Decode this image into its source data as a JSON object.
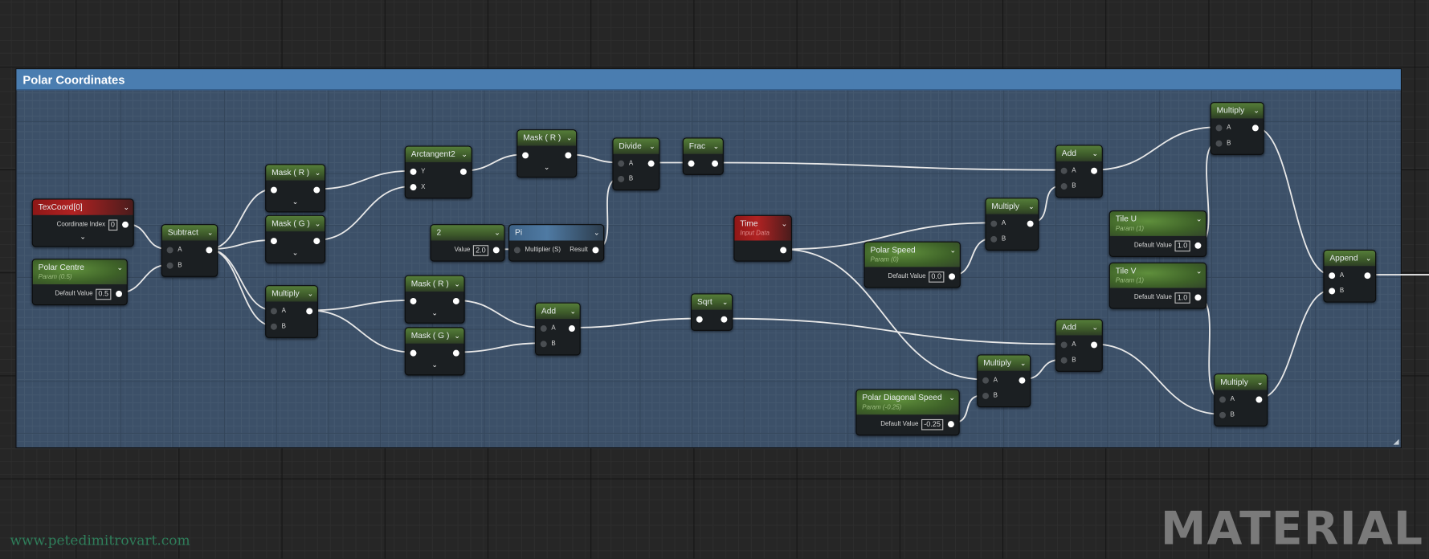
{
  "comment": {
    "title": "Polar Coordinates"
  },
  "graph": {
    "nodes": [
      {
        "title": "TexCoord[0]",
        "color": "red",
        "expand": true,
        "rows": [
          {
            "label": "Coordinate Index",
            "value": "0",
            "out": true
          }
        ]
      },
      {
        "title": "Polar Centre",
        "subtitle": "Param (0.5)",
        "color": "green",
        "rows": [
          {
            "label": "Default Value",
            "value": "0.5",
            "out": true
          }
        ]
      },
      {
        "title": "Subtract",
        "color": "green",
        "rows": [
          {
            "in": "A",
            "out": true
          },
          {
            "in": "B"
          }
        ]
      },
      {
        "title": "Mask ( R )",
        "color": "green",
        "expand": true,
        "rows": [
          {
            "in": "",
            "out": true
          }
        ]
      },
      {
        "title": "Mask ( G )",
        "color": "green",
        "expand": true,
        "rows": [
          {
            "in": "",
            "out": true
          }
        ]
      },
      {
        "title": "Multiply",
        "color": "green",
        "rows": [
          {
            "in": "A",
            "out": true
          },
          {
            "in": "B"
          }
        ]
      },
      {
        "title": "Arctangent2",
        "color": "green",
        "rows": [
          {
            "in": "Y",
            "out": true
          },
          {
            "in": "X"
          }
        ]
      },
      {
        "title": "Mask ( R )",
        "color": "green",
        "expand": true,
        "rows": [
          {
            "in": "",
            "out": true
          }
        ]
      },
      {
        "title": "Divide",
        "color": "green",
        "rows": [
          {
            "in": "A",
            "out": true
          },
          {
            "in": "B"
          }
        ]
      },
      {
        "title": "Frac",
        "color": "green",
        "rows": [
          {
            "in": "",
            "out": true
          }
        ]
      },
      {
        "title": "2",
        "color": "green",
        "rows": [
          {
            "label": "Value",
            "value": "2.0",
            "out": true
          }
        ]
      },
      {
        "title": "Pi",
        "color": "blue",
        "rows": [
          {
            "in": "Multiplier (S)",
            "label": "Result",
            "out": true
          }
        ]
      },
      {
        "title": "Mask ( R )",
        "color": "green",
        "expand": true,
        "rows": [
          {
            "in": "",
            "out": true
          }
        ]
      },
      {
        "title": "Mask ( G )",
        "color": "green",
        "expand": true,
        "rows": [
          {
            "in": "",
            "out": true
          }
        ]
      },
      {
        "title": "Add",
        "color": "green",
        "rows": [
          {
            "in": "A",
            "out": true
          },
          {
            "in": "B"
          }
        ]
      },
      {
        "title": "Sqrt",
        "color": "green",
        "rows": [
          {
            "in": "",
            "out": true
          }
        ]
      },
      {
        "title": "Time",
        "subtitle": "Input Data",
        "color": "red",
        "rows": [
          {
            "out": true
          }
        ]
      },
      {
        "title": "Polar Speed",
        "subtitle": "Param (0)",
        "color": "green",
        "rows": [
          {
            "label": "Default Value",
            "value": "0.0",
            "out": true
          }
        ]
      },
      {
        "title": "Multiply",
        "color": "green",
        "rows": [
          {
            "in": "A",
            "out": true
          },
          {
            "in": "B"
          }
        ]
      },
      {
        "title": "Add",
        "color": "green",
        "rows": [
          {
            "in": "A",
            "out": true
          },
          {
            "in": "B"
          }
        ]
      },
      {
        "title": "Multiply",
        "color": "green",
        "rows": [
          {
            "in": "A",
            "out": true
          },
          {
            "in": "B"
          }
        ]
      },
      {
        "title": "Tile U",
        "subtitle": "Param (1)",
        "color": "green",
        "rows": [
          {
            "label": "Default Value",
            "value": "1.0",
            "out": true
          }
        ]
      },
      {
        "title": "Tile V",
        "subtitle": "Param (1)",
        "color": "green",
        "rows": [
          {
            "label": "Default Value",
            "value": "1.0",
            "out": true
          }
        ]
      },
      {
        "title": "Append",
        "color": "green",
        "rows": [
          {
            "in": "A",
            "out": true
          },
          {
            "in": "B"
          }
        ]
      },
      {
        "title": "Add",
        "color": "green",
        "rows": [
          {
            "in": "A",
            "out": true
          },
          {
            "in": "B"
          }
        ]
      },
      {
        "title": "Multiply",
        "color": "green",
        "rows": [
          {
            "in": "A",
            "out": true
          },
          {
            "in": "B"
          }
        ]
      },
      {
        "title": "Polar Diagonal Speed",
        "subtitle": "Param (-0.25)",
        "color": "green",
        "rows": [
          {
            "label": "Default Value",
            "value": "-0.25",
            "out": true
          }
        ]
      },
      {
        "title": "Multiply",
        "color": "green",
        "rows": [
          {
            "in": "A",
            "out": true
          },
          {
            "in": "B"
          }
        ]
      }
    ]
  },
  "watermark": {
    "url": "www.petedimitrovart.com",
    "label": "MATERIAL"
  },
  "colors": {
    "comment_header": "#4a7db0",
    "wire": "#e8e8e8",
    "url": "#2f7d5a"
  }
}
